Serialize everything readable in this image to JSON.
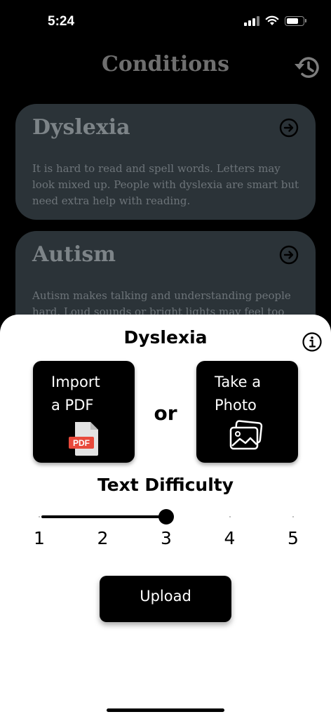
{
  "status_bar": {
    "time": "5:24",
    "signal_icon": "cellular-signal-icon",
    "wifi_icon": "wifi-icon",
    "battery_icon": "battery-icon",
    "battery_level": 0.75
  },
  "header": {
    "title": "Conditions",
    "history_icon": "history-icon"
  },
  "cards": [
    {
      "title": "Dyslexia",
      "description": "It is hard to read and spell words. Letters may look mixed up. People with dyslexia are smart but need extra help with reading.",
      "icon": "arrow-right-circle-icon"
    },
    {
      "title": "Autism",
      "description": "Autism makes talking and understanding people hard. Loud sounds or bright lights may feel too",
      "icon": "arrow-right-circle-icon"
    }
  ],
  "sheet": {
    "title": "Dyslexia",
    "info_icon": "info-icon",
    "import_label": "Import\na PDF",
    "pdf_badge": "PDF",
    "or_label": "or",
    "photo_label": "Take a\nPhoto",
    "difficulty_title": "Text Difficulty",
    "difficulty": {
      "min": 1,
      "max": 5,
      "value": 3,
      "labels": [
        "1",
        "2",
        "3",
        "4",
        "5"
      ]
    },
    "upload_label": "Upload"
  },
  "colors": {
    "background": "#000000",
    "card": "#2b3338",
    "sheet": "#ffffff",
    "pdf_red": "#e8493b"
  }
}
